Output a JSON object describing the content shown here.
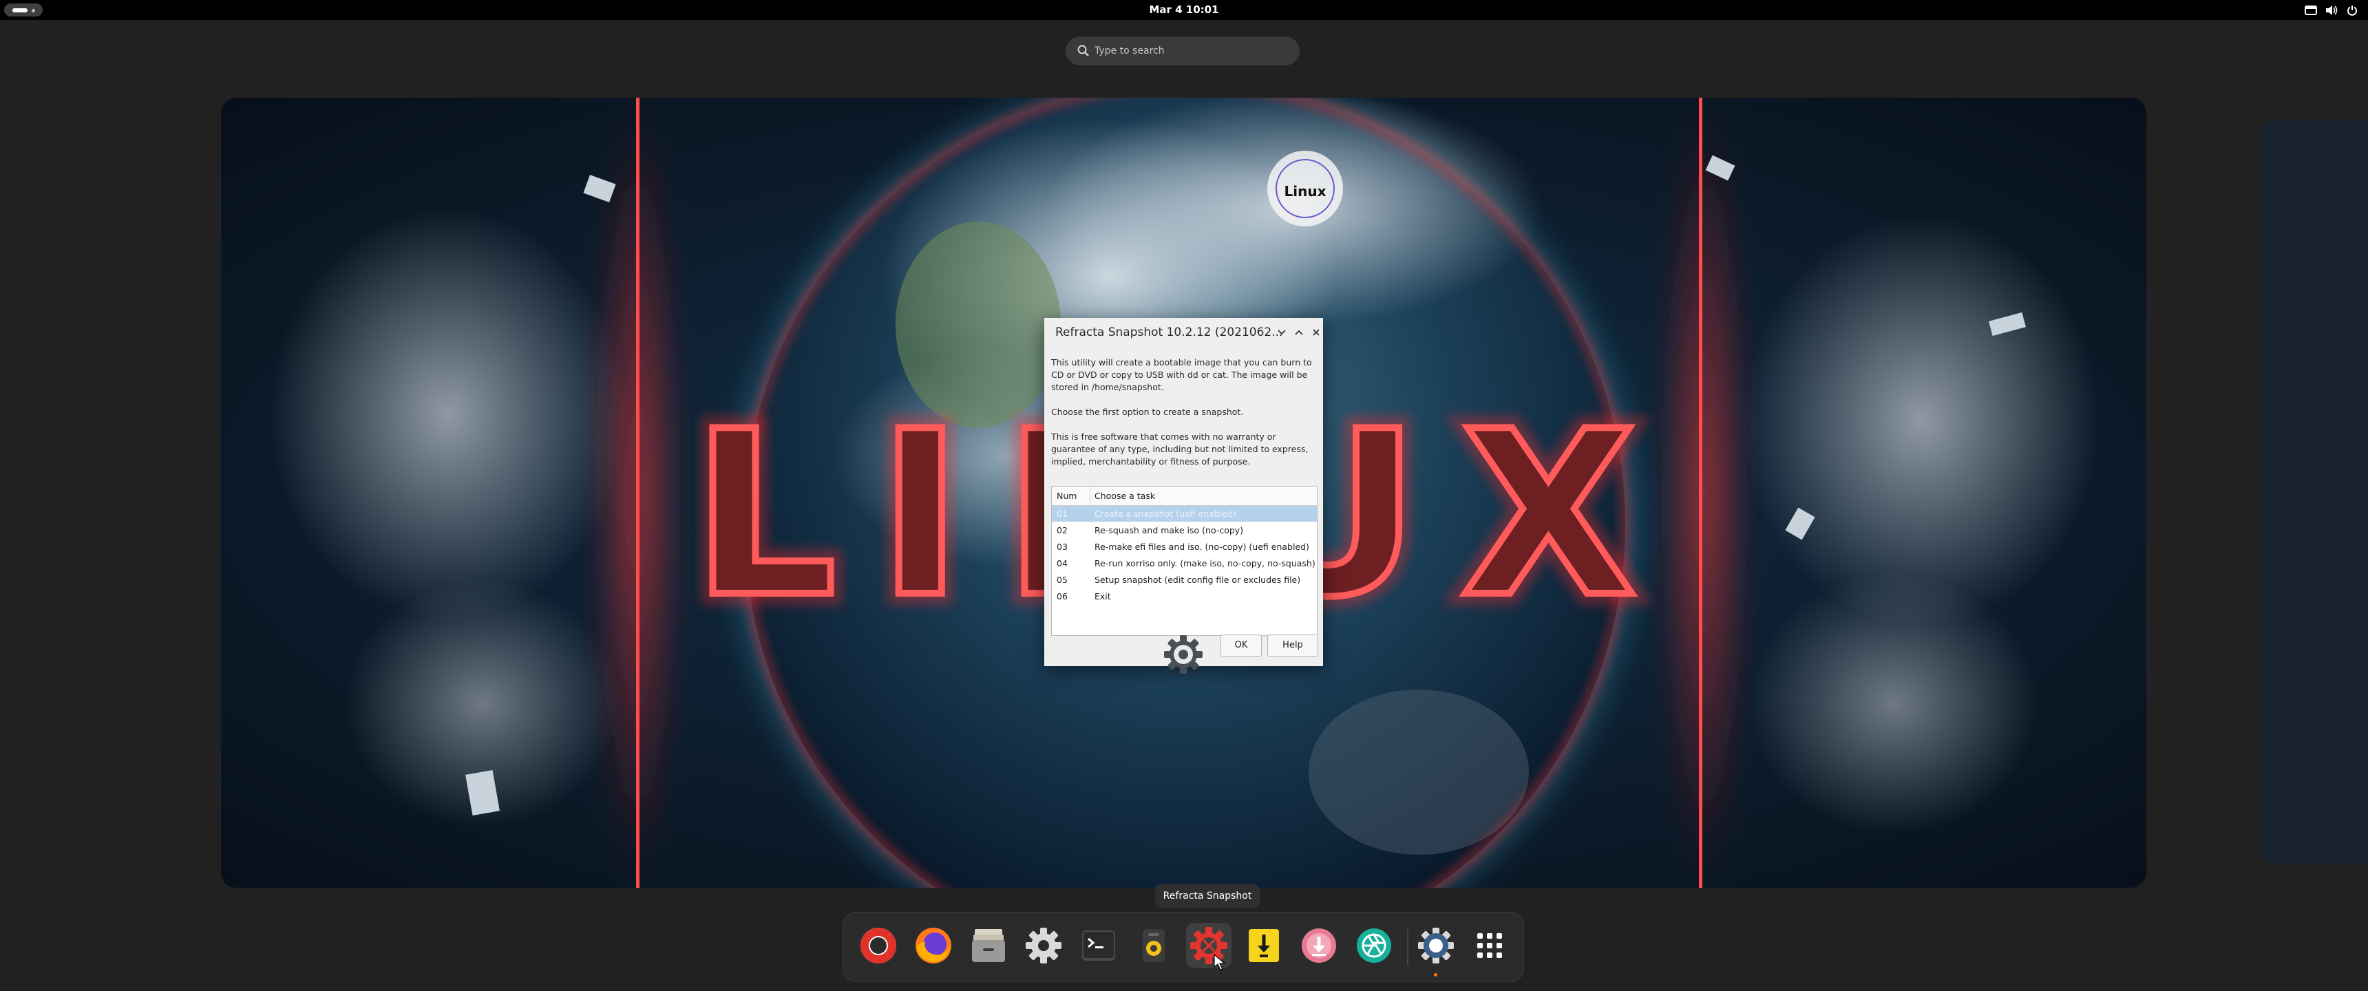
{
  "topbar": {
    "clock": "Mar 4  10:01",
    "tray_icons": [
      "window-icon",
      "volume-icon",
      "power-icon"
    ]
  },
  "search": {
    "placeholder": "Type to search"
  },
  "wallpaper": {
    "headline": "LINUX",
    "badge_brand": "Linux"
  },
  "dialog": {
    "title": "Refracta Snapshot 10.2.12 (2021062...",
    "description_1": "This utility will create a bootable image that you can burn to CD or DVD or copy to USB with dd or cat. The image will be stored in /home/snapshot.",
    "description_2": "Choose the first option to create a snapshot.",
    "description_3": "This is free software that comes with no warranty or guarantee of any type, including but not limited to express, implied, merchantability or fitness of purpose.",
    "columns": {
      "num": "Num",
      "task": "Choose a task"
    },
    "tasks": [
      {
        "num": "01",
        "label": "Create a snapshot (uefi enabled)",
        "selected": true
      },
      {
        "num": "02",
        "label": "Re-squash and make iso (no-copy)",
        "selected": false
      },
      {
        "num": "03",
        "label": "Re-make efi files and iso. (no-copy) (uefi enabled)",
        "selected": false
      },
      {
        "num": "04",
        "label": "Re-run xorriso only. (make iso, no-copy, no-squash)",
        "selected": false
      },
      {
        "num": "05",
        "label": "Setup snapshot (edit config file or excludes file)",
        "selected": false
      },
      {
        "num": "06",
        "label": "Exit",
        "selected": false
      }
    ],
    "ok_label": "OK",
    "help_label": "Help"
  },
  "dock": {
    "tooltip": "Refracta Snapshot",
    "apps": [
      {
        "name": "help-icon",
        "active": false
      },
      {
        "name": "firefox-icon",
        "active": false
      },
      {
        "name": "files-icon",
        "active": false
      },
      {
        "name": "settings-icon",
        "active": false
      },
      {
        "name": "terminal-icon",
        "active": false
      },
      {
        "name": "media-player-icon",
        "active": false
      },
      {
        "name": "refracta-snapshot-icon",
        "active": true
      },
      {
        "name": "installer-icon",
        "active": false
      },
      {
        "name": "download-icon",
        "active": false
      },
      {
        "name": "camera-shutter-icon",
        "active": false
      },
      {
        "name": "settings-running-icon",
        "active": false
      },
      {
        "name": "app-grid-icon",
        "active": false
      }
    ]
  },
  "colors": {
    "topbar": "#000000",
    "shell_background": "#212121",
    "dialog_background": "#efefef",
    "selection": "#b6d1ec",
    "accent_red": "#ff3b3b",
    "running_indicator": "#ff7a00"
  }
}
